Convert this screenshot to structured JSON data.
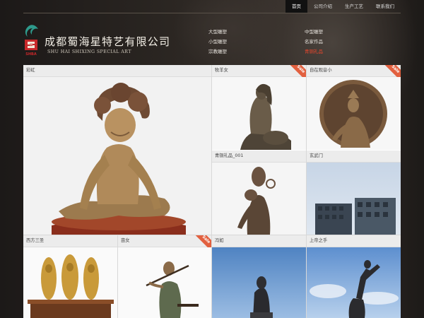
{
  "topnav": {
    "items": [
      {
        "label": "首页",
        "active": true
      },
      {
        "label": "公司介绍",
        "active": false
      },
      {
        "label": "生产工艺",
        "active": false
      },
      {
        "label": "联系我们",
        "active": false
      }
    ]
  },
  "logo": {
    "cn": "成都蜀海星特艺有限公司",
    "en": "SHU HAI SHIXING SPECIAL ART",
    "mark_text": "SHBA"
  },
  "categories": {
    "left": [
      "大型雕塑",
      "小型雕塑",
      "宗教雕塑"
    ],
    "right": [
      "中型雕塑",
      "名家作品",
      "青铜礼品"
    ],
    "highlight": "青铜礼品"
  },
  "tiles": [
    {
      "caption": "彩虹",
      "sale": false
    },
    {
      "caption": "牧羊女",
      "sale": true
    },
    {
      "caption": "自在观音小",
      "sale": true
    },
    {
      "caption": "青铜礼品_001",
      "sale": false
    },
    {
      "caption": "玄武门",
      "sale": false
    },
    {
      "caption": "西方三圣",
      "sale": false
    },
    {
      "caption": "亩女",
      "sale": true
    },
    {
      "caption": "冯如",
      "sale": false
    },
    {
      "caption": "上帝之手",
      "sale": false
    }
  ],
  "sale_label": "Sale",
  "colors": {
    "accent_red": "#e8472d",
    "sale_badge": "#e2603f",
    "background": "#2a2522"
  }
}
